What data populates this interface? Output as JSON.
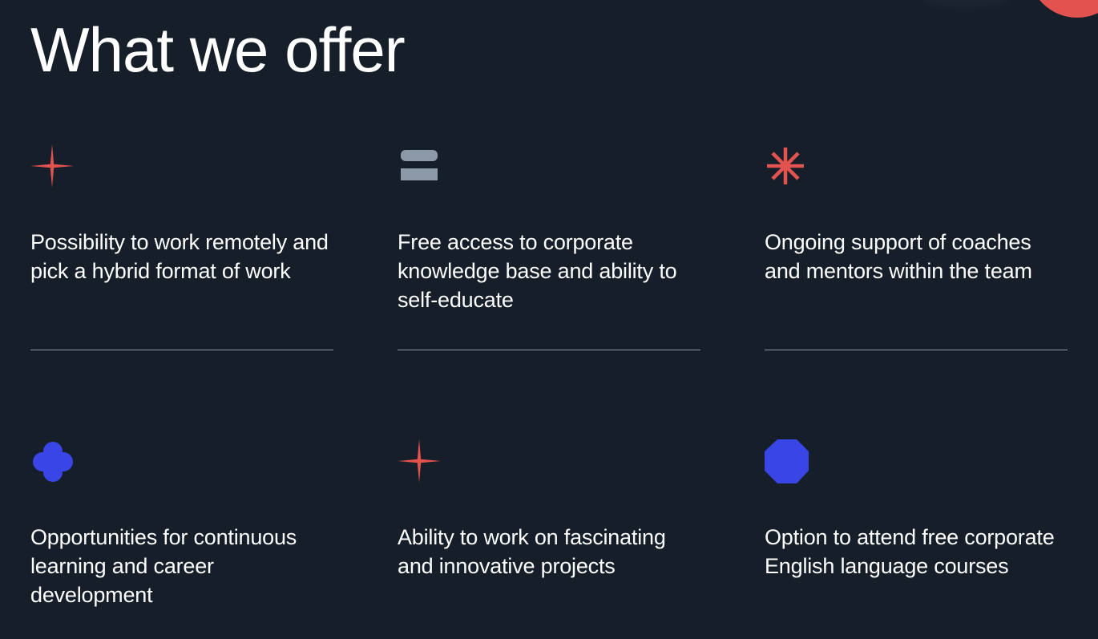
{
  "page": {
    "title": "What we offer"
  },
  "colors": {
    "background": "#151e29",
    "accent_red": "#e2524e",
    "accent_blue": "#3a45e6",
    "accent_gray": "#8c99a8",
    "text": "#ffffff"
  },
  "offers": [
    {
      "icon": "sparkle-icon",
      "text": "Possibility to work remotely and pick a hybrid format of work"
    },
    {
      "icon": "stacked-bars-icon",
      "text": "Free access to corporate knowledge base and ability to self-educate"
    },
    {
      "icon": "asterisk-icon",
      "text": "Ongoing support of coaches and mentors within the team"
    },
    {
      "icon": "clover-icon",
      "text": "Opportunities for continuous learning and career development"
    },
    {
      "icon": "sparkle-icon",
      "text": "Ability to work on fascinating and innovative projects"
    },
    {
      "icon": "octagon-icon",
      "text": "Option to attend free corporate English language courses"
    }
  ]
}
